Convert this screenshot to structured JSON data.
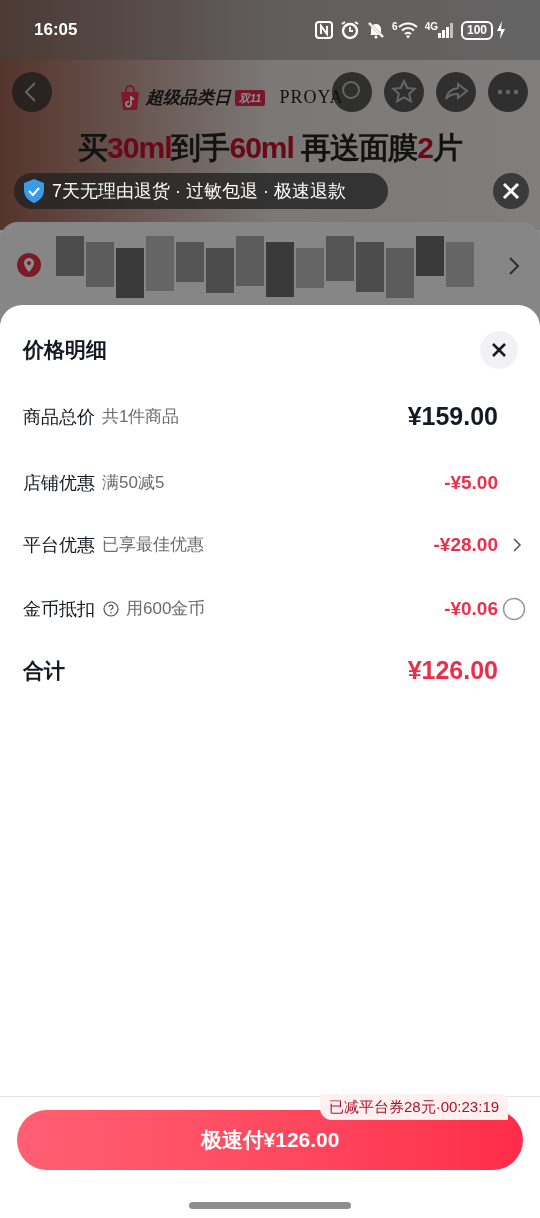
{
  "status_bar": {
    "time": "16:05",
    "wifi_badge": "6",
    "network": "4G",
    "battery": "100",
    "charging_icon": true
  },
  "banner": {
    "event": "超级品类日",
    "event_tag": "双11",
    "brand": "PROYA",
    "headline": [
      {
        "text": "买",
        "highlight": false
      },
      {
        "text": "30ml",
        "highlight": true
      },
      {
        "text": "到手",
        "highlight": false
      },
      {
        "text": "60ml",
        "highlight": true
      },
      {
        "text": " 再送面膜",
        "highlight": false
      },
      {
        "text": "2",
        "highlight": true
      },
      {
        "text": "片",
        "highlight": false
      }
    ]
  },
  "guarantee": {
    "items": [
      "7天无理由退货",
      "过敏包退",
      "极速退款"
    ],
    "separator": "·"
  },
  "sheet": {
    "title": "价格明细",
    "rows": [
      {
        "kind": "plain",
        "label": "商品总价",
        "detail": "共1件商品",
        "amount": "¥159.00"
      },
      {
        "kind": "plain",
        "label": "店铺优惠",
        "detail": "满50减5",
        "amount": "-¥5.00"
      },
      {
        "kind": "chevron",
        "label": "平台优惠",
        "detail": "已享最佳优惠",
        "amount": "-¥28.00"
      },
      {
        "kind": "radio",
        "label": "金币抵扣",
        "detail": "用600金币",
        "amount": "-¥0.06",
        "help": true,
        "selected": false
      }
    ],
    "total": {
      "label": "合计",
      "amount": "¥126.00"
    }
  },
  "footer": {
    "coupon_tag": "已减平台券28元·00:23:19",
    "pay_button": "极速付¥126.00"
  }
}
